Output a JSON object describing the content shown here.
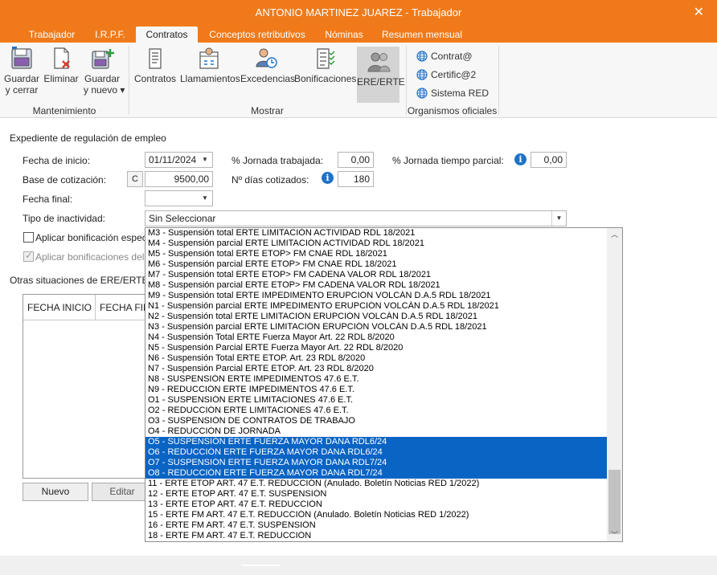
{
  "window": {
    "title": "ANTONIO MARTINEZ JUAREZ - Trabajador",
    "close_glyph": "✕"
  },
  "tabs": [
    {
      "label": "Trabajador"
    },
    {
      "label": "I.R.P.F."
    },
    {
      "label": "Contratos"
    },
    {
      "label": "Conceptos retributivos"
    },
    {
      "label": "Nóminas"
    },
    {
      "label": "Resumen mensual"
    }
  ],
  "active_tab": "Contratos",
  "ribbon": {
    "mantenimiento": {
      "label": "Mantenimiento",
      "save_close_1": "Guardar",
      "save_close_2": "y cerrar",
      "delete": "Eliminar",
      "save_new_1": "Guardar",
      "save_new_2": "y nuevo ▾"
    },
    "mostrar": {
      "label": "Mostrar",
      "contratos": "Contratos",
      "llamamientos": "Llamamientos",
      "excedencias": "Excedencias",
      "bonificaciones": "Bonificaciones",
      "ere": "ERE/ERTE"
    },
    "organismos": {
      "label": "Organismos oficiales",
      "contrata": "Contrat@",
      "certifica": "Certific@2",
      "sistema_red": "Sistema RED"
    }
  },
  "form": {
    "section_title": "Expediente de regulación de empleo",
    "fecha_inicio_label": "Fecha de inicio:",
    "fecha_inicio_value": "01/11/2024",
    "jornada_trabajada_label": "% Jornada trabajada:",
    "jornada_trabajada_value": "0,00",
    "jornada_parcial_label": "% Jornada tiempo parcial:",
    "jornada_parcial_value": "0,00",
    "base_cotizacion_label": "Base de cotización:",
    "base_cotizacion_button": "C",
    "base_cotizacion_value": "9500,00",
    "dias_cotizados_label": "Nº días cotizados:",
    "dias_cotizados_value": "180",
    "fecha_final_label": "Fecha final:",
    "fecha_final_value": "",
    "tipo_inactividad_label": "Tipo de inactividad:",
    "tipo_inactividad_value": "Sin Seleccionar",
    "bonificacion_label": "Aplicar bonificación espec",
    "bonificaciones_label": "Aplicar bonificaciones del",
    "otras_situaciones_title": "Otras situaciones de ERE/ERTE",
    "grid_columns": [
      "FECHA INICIO",
      "FECHA FIN"
    ],
    "nuevo_button": "Nuevo",
    "editar_button": "Editar"
  },
  "dropdown": {
    "items": [
      {
        "label": "M3 - Suspensión total ERTE LIMITACIÓN ACTIVIDAD RDL 18/2021",
        "selected": false
      },
      {
        "label": "M4 - Suspensión parcial ERTE LIMITACIÓN ACTIVIDAD RDL 18/2021",
        "selected": false
      },
      {
        "label": "M5 - Suspensión total ERTE ETOP> FM CNAE RDL 18/2021",
        "selected": false
      },
      {
        "label": "M6 - Suspensión parcial ERTE ETOP> FM CNAE RDL 18/2021",
        "selected": false
      },
      {
        "label": "M7 - Suspensión total ERTE ETOP> FM CADENA VALOR RDL 18/2021",
        "selected": false
      },
      {
        "label": "M8 - Suspensión parcial ERTE ETOP> FM CADENA VALOR RDL 18/2021",
        "selected": false
      },
      {
        "label": "M9 - Suspensión total ERTE IMPEDIMENTO ERUPCIÓN VOLCÁN D.A.5 RDL 18/2021",
        "selected": false
      },
      {
        "label": "N1 - Suspensión parcial ERTE IMPEDIMENTO ERUPCIÓN VOLCÁN D.A.5 RDL 18/2021",
        "selected": false
      },
      {
        "label": "N2 - Suspensión total ERTE LIMITACIÓN ERUPCIÓN VOLCÁN D.A.5 RDL 18/2021",
        "selected": false
      },
      {
        "label": "N3 - Suspensión parcial ERTE LIMITACIÓN ERUPCIÓN VOLCÁN D.A.5 RDL 18/2021",
        "selected": false
      },
      {
        "label": "N4 - Suspensión Total ERTE Fuerza Mayor Art. 22 RDL 8/2020",
        "selected": false
      },
      {
        "label": "N5 - Suspensión Parcial ERTE Fuerza Mayor Art. 22 RDL 8/2020",
        "selected": false
      },
      {
        "label": "N6 - Suspensión Total ERTE ETOP. Art. 23 RDL 8/2020",
        "selected": false
      },
      {
        "label": "N7 - Suspensión Parcial ERTE ETOP. Art. 23 RDL 8/2020",
        "selected": false
      },
      {
        "label": "N8 - SUSPENSIÓN ERTE IMPEDIMENTOS 47.6 E.T.",
        "selected": false
      },
      {
        "label": "N9 - REDUCCIÓN ERTE IMPEDIMENTOS 47.6 E.T.",
        "selected": false
      },
      {
        "label": "O1 - SUSPENSIÓN ERTE LIMITACIONES 47.6 E.T.",
        "selected": false
      },
      {
        "label": "O2 - REDUCCIÓN ERTE LIMITACIONES 47.6 E.T.",
        "selected": false
      },
      {
        "label": "O3 - SUSPENSIÓN DE CONTRATOS DE TRABAJO",
        "selected": false
      },
      {
        "label": "O4 - REDUCCIÓN DE JORNADA",
        "selected": false
      },
      {
        "label": "O5 - SUSPENSIÓN ERTE FUERZA MAYOR DANA RDL6/24",
        "selected": true
      },
      {
        "label": "O6 - REDUCCIÓN ERTE FUERZA MAYOR DANA RDL6/24",
        "selected": true
      },
      {
        "label": "O7 - SUSPENSIÓN ERTE FUERZA MAYOR DANA RDL7/24",
        "selected": true
      },
      {
        "label": "O8 - REDUCCIÓN ERTE FUERZA MAYOR DANA RDL7/24",
        "selected": true
      },
      {
        "label": "11 - ERTE ETOP ART. 47 E.T. REDUCCIÓN (Anulado. Boletín Noticias RED 1/2022)",
        "selected": false
      },
      {
        "label": "12 - ERTE ETOP ART. 47 E.T. SUSPENSIÓN",
        "selected": false
      },
      {
        "label": "13 - ERTE ETOP ART. 47 E.T. REDUCCIÓN",
        "selected": false
      },
      {
        "label": "15 - ERTE FM ART. 47 E.T. REDUCCIÓN (Anulado. Boletín Noticias RED 1/2022)",
        "selected": false
      },
      {
        "label": "16 - ERTE FM ART. 47 E.T. SUSPENSIÓN",
        "selected": false
      },
      {
        "label": "18 - ERTE FM ART. 47 E.T. REDUCCIÓN",
        "selected": false
      }
    ]
  },
  "colors": {
    "accent": "#f07a1a",
    "selection": "#0a64c4",
    "info": "#1e73c8"
  },
  "icons": [
    "save-close-icon",
    "delete-icon",
    "save-new-icon",
    "contracts-icon",
    "calls-icon",
    "leave-icon",
    "bonus-icon",
    "ere-icon",
    "globe-icon",
    "info-icon",
    "close-icon",
    "chevron-down-icon"
  ]
}
